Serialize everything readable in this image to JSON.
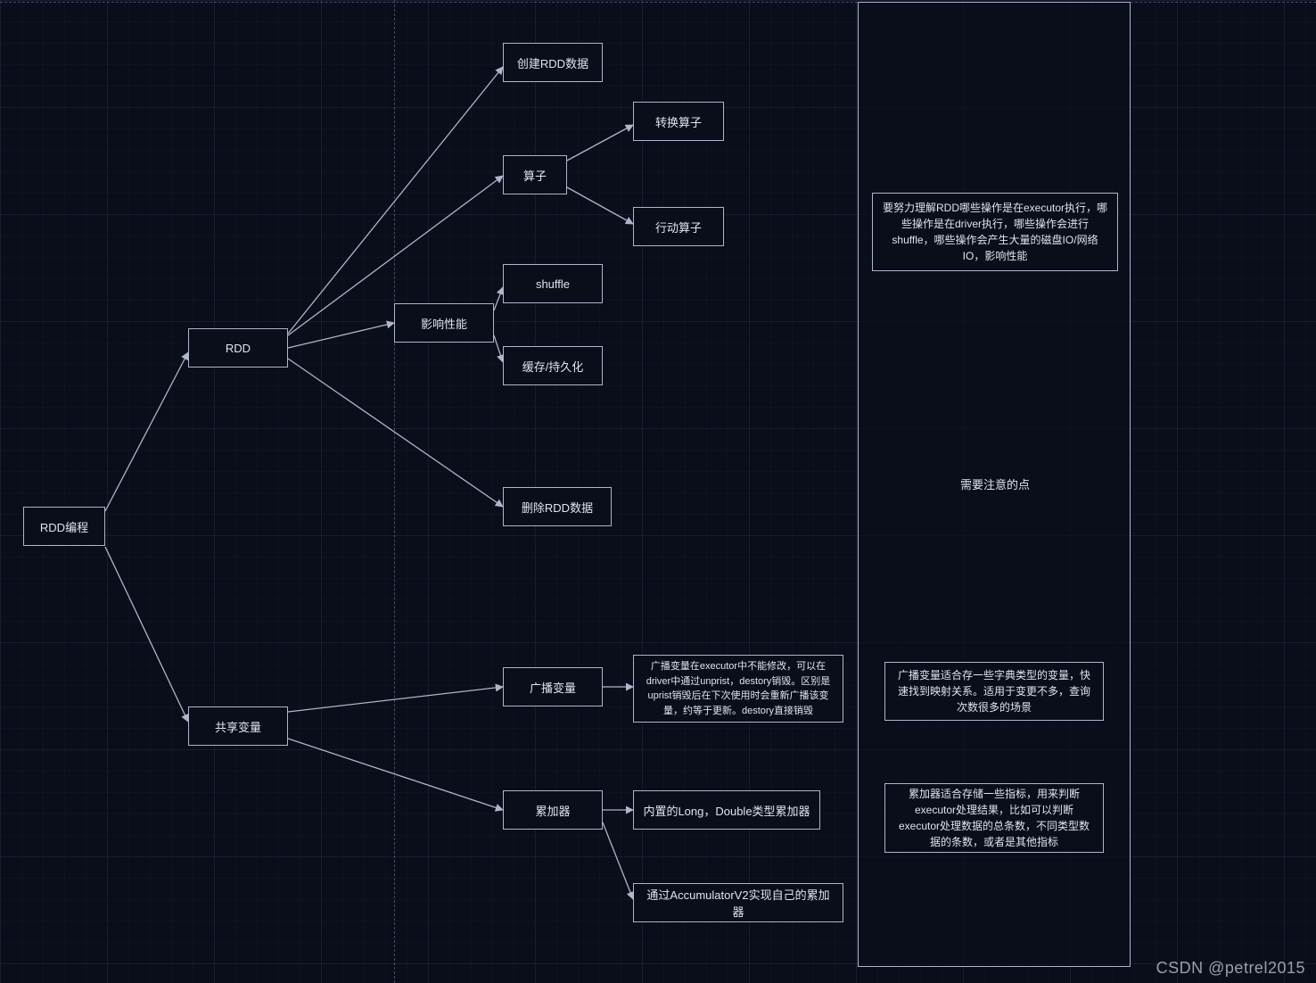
{
  "nodes": {
    "root": "RDD编程",
    "rdd": "RDD",
    "shared": "共享变量",
    "create": "创建RDD数据",
    "operator": "算子",
    "transform": "转换算子",
    "action": "行动算子",
    "perf": "影响性能",
    "shuffle": "shuffle",
    "cache": "缓存/持久化",
    "delete": "删除RDD数据",
    "broadcast": "广播变量",
    "broadcast_desc": "广播变量在executor中不能修改，可以在driver中通过unprist，destory销毁。区别是uprist销毁后在下次使用时会重新广播该变量，约等于更新。destory直接销毁",
    "accumulator": "累加器",
    "acc_builtin": "内置的Long，Double类型累加器",
    "acc_custom": "通过AccumulatorV2实现自己的累加器",
    "side_title": "需要注意的点",
    "side_exec": "要努力理解RDD哪些操作是在executor执行，哪些操作是在driver执行，哪些操作会进行shuffle，哪些操作会产生大量的磁盘IO/网络IO，影响性能",
    "side_broadcast": "广播变量适合存一些字典类型的变量，快速找到映射关系。适用于变更不多，查询次数很多的场景",
    "side_acc": "累加器适合存储一些指标，用来判断executor处理结果，比如可以判断executor处理数据的总条数，不同类型数据的条数，或者是其他指标"
  },
  "watermark": "CSDN @petrel2015",
  "colors": {
    "stroke": "#aeb6cc",
    "text": "#dfe4f0"
  }
}
